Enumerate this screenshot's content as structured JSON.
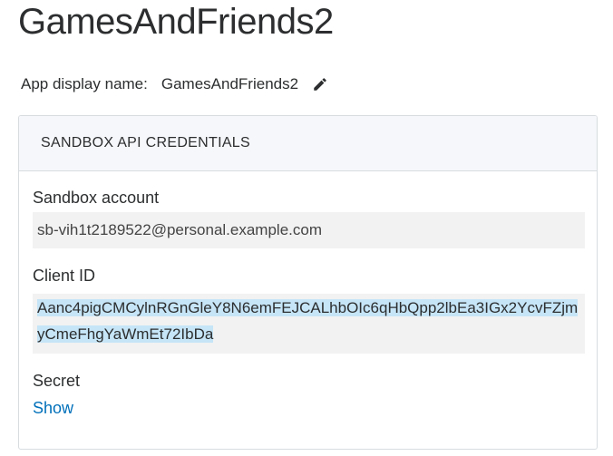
{
  "app": {
    "title": "GamesAndFriends2",
    "display_name_label": "App display name:",
    "display_name_value": "GamesAndFriends2"
  },
  "credentials": {
    "section_title": "SANDBOX API CREDENTIALS",
    "account_label": "Sandbox account",
    "account_value": "sb-vih1t2189522@personal.example.com",
    "client_id_label": "Client ID",
    "client_id_value": "Aanc4pigCMCylnRGnGleY8N6emFEJCALhbOIc6qHbQpp2lbEa3IGx2YcvFZjmyCmeFhgYaWmEt72IbDa",
    "secret_label": "Secret",
    "secret_action": "Show"
  },
  "colors": {
    "link": "#0070ba",
    "selection": "#c6e5f7",
    "field_bg": "#f2f2f2",
    "header_bg": "#f5f7fa"
  },
  "icons": {
    "edit": "pencil-icon"
  }
}
